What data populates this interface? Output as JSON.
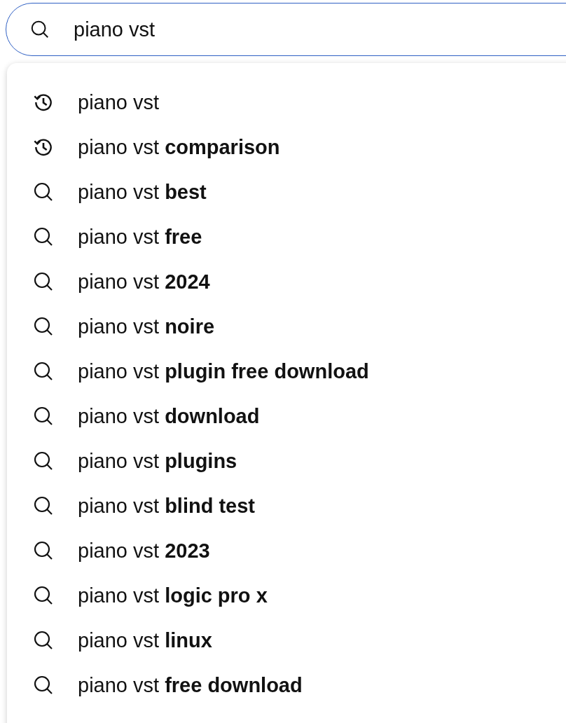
{
  "search": {
    "value": "piano vst"
  },
  "suggestions": [
    {
      "kind": "history",
      "text": "piano vst"
    },
    {
      "kind": "history",
      "text": "piano vst **comparison**"
    },
    {
      "kind": "search",
      "text": "piano vst **best**"
    },
    {
      "kind": "search",
      "text": "piano vst **free**"
    },
    {
      "kind": "search",
      "text": "piano vst **2024**"
    },
    {
      "kind": "search",
      "text": "piano vst **noire**"
    },
    {
      "kind": "search",
      "text": "piano vst **plugin free download**"
    },
    {
      "kind": "search",
      "text": "piano vst **download**"
    },
    {
      "kind": "search",
      "text": "piano vst **plugins**"
    },
    {
      "kind": "search",
      "text": "piano vst **blind test**"
    },
    {
      "kind": "search",
      "text": "piano vst **2023**"
    },
    {
      "kind": "search",
      "text": "piano vst **logic pro x**"
    },
    {
      "kind": "search",
      "text": "piano vst **linux**"
    },
    {
      "kind": "search",
      "text": "piano vst **free download**"
    }
  ]
}
